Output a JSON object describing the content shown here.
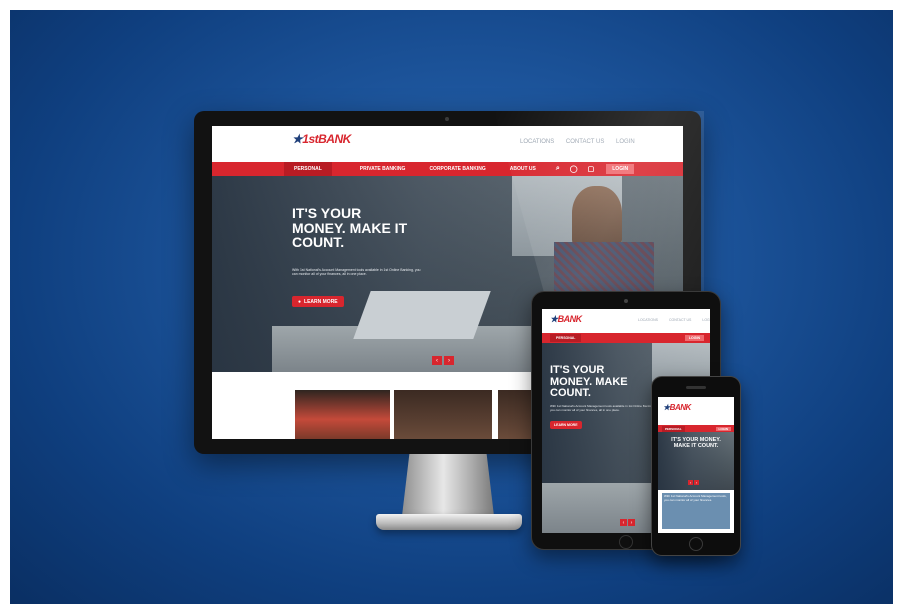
{
  "brand": {
    "logo_text": "BANK",
    "logo_prefix": "1st",
    "accent": "#d8262e",
    "navy": "#1f3f7a"
  },
  "utility_links": [
    "LOCATIONS",
    "CONTACT US",
    "LOGIN"
  ],
  "nav": {
    "items": [
      "PERSONAL",
      "PRIVATE BANKING",
      "CORPORATE BANKING",
      "ABOUT US"
    ],
    "login_label": "LOGIN"
  },
  "desktop": {
    "headline": [
      "IT'S YOUR",
      "MONEY. MAKE IT",
      "COUNT."
    ],
    "body": "With 1st National's Account Management tools available in 1st Online Banking, you can monitor all of your finances, all in one place.",
    "cta": "LEARN MORE"
  },
  "tablet": {
    "headline": [
      "IT'S YOUR",
      "MONEY. MAKE",
      "COUNT."
    ],
    "cta": "LEARN MORE"
  },
  "phone": {
    "headline": [
      "IT'S YOUR MONEY.",
      "MAKE IT COUNT."
    ],
    "card_text": "With 1st National's Account Management tools, you can monitor all of your finances."
  },
  "icons": [
    "search-icon",
    "globe-icon",
    "lock-icon",
    "chevron-left-icon",
    "chevron-right-icon"
  ]
}
